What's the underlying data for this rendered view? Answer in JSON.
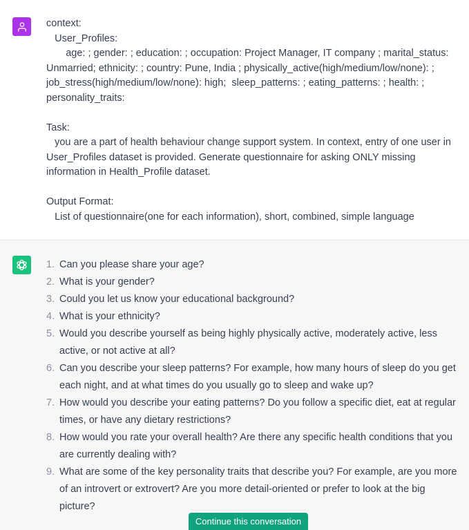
{
  "user_message": {
    "avatar_icon": "user-icon",
    "avatar_color": "#ab34e8",
    "text": "context:\n   User_Profiles:\n       age: ; gender: ; education: ; occupation: Project Manager, IT company ; marital_status: Unmarried; ethnicity: ; country: Pune, India ; physically_active(high/medium/low/none): ; job_stress(high/medium/low/none): high;  sleep_patterns: ; eating_patterns: ; health: ; personality_traits:\n\nTask:\n   you are a part of health behaviour change support system. In context, entry of one user in User_Profiles dataset is provided. Generate questionnaire for asking ONLY missing information in Health_Profile dataset.\n\nOutput Format:\n   List of questionnaire(one for each information), short, combined, simple language"
  },
  "assistant_message": {
    "avatar_icon": "openai-logo-icon",
    "avatar_color": "#19c37d",
    "items": [
      {
        "num": "1.",
        "text": "Can you please share your age?"
      },
      {
        "num": "2.",
        "text": "What is your gender?"
      },
      {
        "num": "3.",
        "text": "Could you let us know your educational background?"
      },
      {
        "num": "4.",
        "text": "What is your ethnicity?"
      },
      {
        "num": "5.",
        "text": "Would you describe yourself as being highly physically active, moderately active, less active, or not active at all?"
      },
      {
        "num": "6.",
        "text": "Can you describe your sleep patterns? For example, how many hours of sleep do you get each night, and at what times do you usually go to sleep and wake up?"
      },
      {
        "num": "7.",
        "text": "How would you describe your eating patterns? Do you follow a specific diet, eat at regular times, or have any dietary restrictions?"
      },
      {
        "num": "8.",
        "text": "How would you rate your overall health? Are there any specific health conditions that you are currently dealing with?"
      },
      {
        "num": "9.",
        "text": "What are some of the key personality traits that describe you? For example, are you more of an introvert or extrovert? Are you more detail-oriented or prefer to look at the big picture?"
      }
    ]
  },
  "continue_button": {
    "label": "Continue this conversation",
    "color": "#10a37f"
  }
}
